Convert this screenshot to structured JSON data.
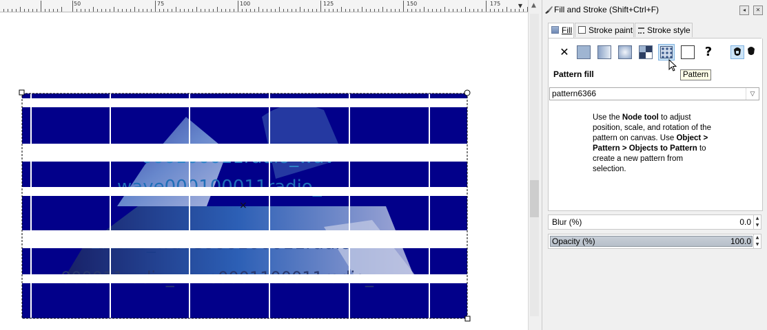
{
  "ruler": {
    "labels": [
      "50",
      "75",
      "100",
      "125",
      "150",
      "175"
    ]
  },
  "canvas": {
    "pattern_color": "#02008a",
    "text_lines": [
      "000100011radio_wav",
      "wave000100011radio_",
      "1radio_wave000100011radio",
      "000011radio_wave0001100011radio_"
    ],
    "center_mark": "×"
  },
  "dialog": {
    "title": "Fill and Stroke (Shift+Ctrl+F)",
    "title_buttons": [
      "◂",
      "✕"
    ],
    "tabs": [
      {
        "label": "Fill"
      },
      {
        "label": "Stroke paint"
      },
      {
        "label": "Stroke style"
      }
    ],
    "paint_buttons": [
      {
        "name": "no-paint",
        "glyph": "✕"
      },
      {
        "name": "flat-color"
      },
      {
        "name": "linear-gradient"
      },
      {
        "name": "radial-gradient"
      },
      {
        "name": "mesh-gradient"
      },
      {
        "name": "pattern"
      },
      {
        "name": "swatch"
      },
      {
        "name": "unset",
        "glyph": "?"
      }
    ],
    "fill_rule_buttons": [
      {
        "name": "evenodd"
      },
      {
        "name": "nonzero"
      }
    ],
    "section_label": "Pattern fill",
    "pattern_select": {
      "value": "pattern6366"
    },
    "tooltip": "Pattern",
    "help": {
      "p1": "Use the ",
      "b1": "Node tool",
      "p2": " to adjust position, scale, and rotation of the pattern on canvas. Use ",
      "b2": "Object > Pattern > Objects to Pattern",
      "p3": " to create a new pattern from selection."
    },
    "blur": {
      "label": "Blur (%)",
      "value": "0.0"
    },
    "opacity": {
      "label": "Opacity (%)",
      "value": "100.0",
      "level": 1.0
    }
  },
  "colors": {
    "accent_blue": "#02008a",
    "selection_dash": "#000000",
    "active_button": "#cce4f7"
  }
}
